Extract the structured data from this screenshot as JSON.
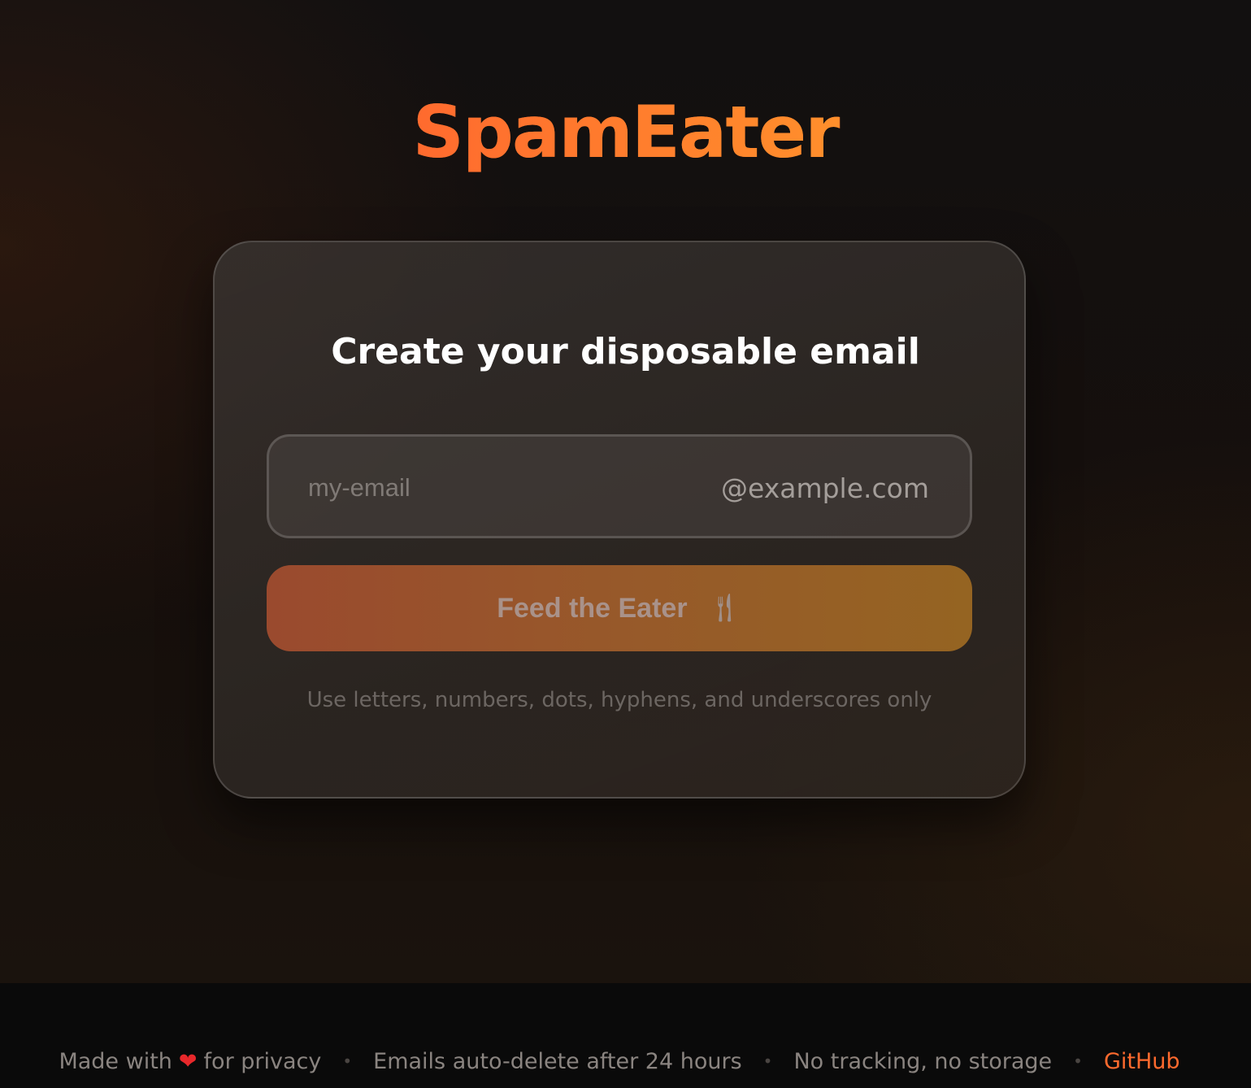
{
  "app": {
    "logo": "SpamEater"
  },
  "card": {
    "title": "Create your disposable email",
    "email_input": {
      "placeholder": "my-email",
      "value": ""
    },
    "domain_suffix": "@example.com",
    "submit_label": "Feed the Eater",
    "submit_icon": "fork-knife-icon",
    "hint": "Use letters, numbers, dots, hyphens, and underscores only"
  },
  "footer": {
    "made_with_prefix": "Made with",
    "heart_icon": "heart-icon",
    "made_with_suffix": "for privacy",
    "separator": "•",
    "auto_delete": "Emails auto-delete after 24 hours",
    "no_tracking": "No tracking, no storage",
    "github_label": "GitHub"
  },
  "colors": {
    "accent": "#ff6a2e",
    "accent_end": "#ff8c2a",
    "heart": "#e8282b"
  }
}
